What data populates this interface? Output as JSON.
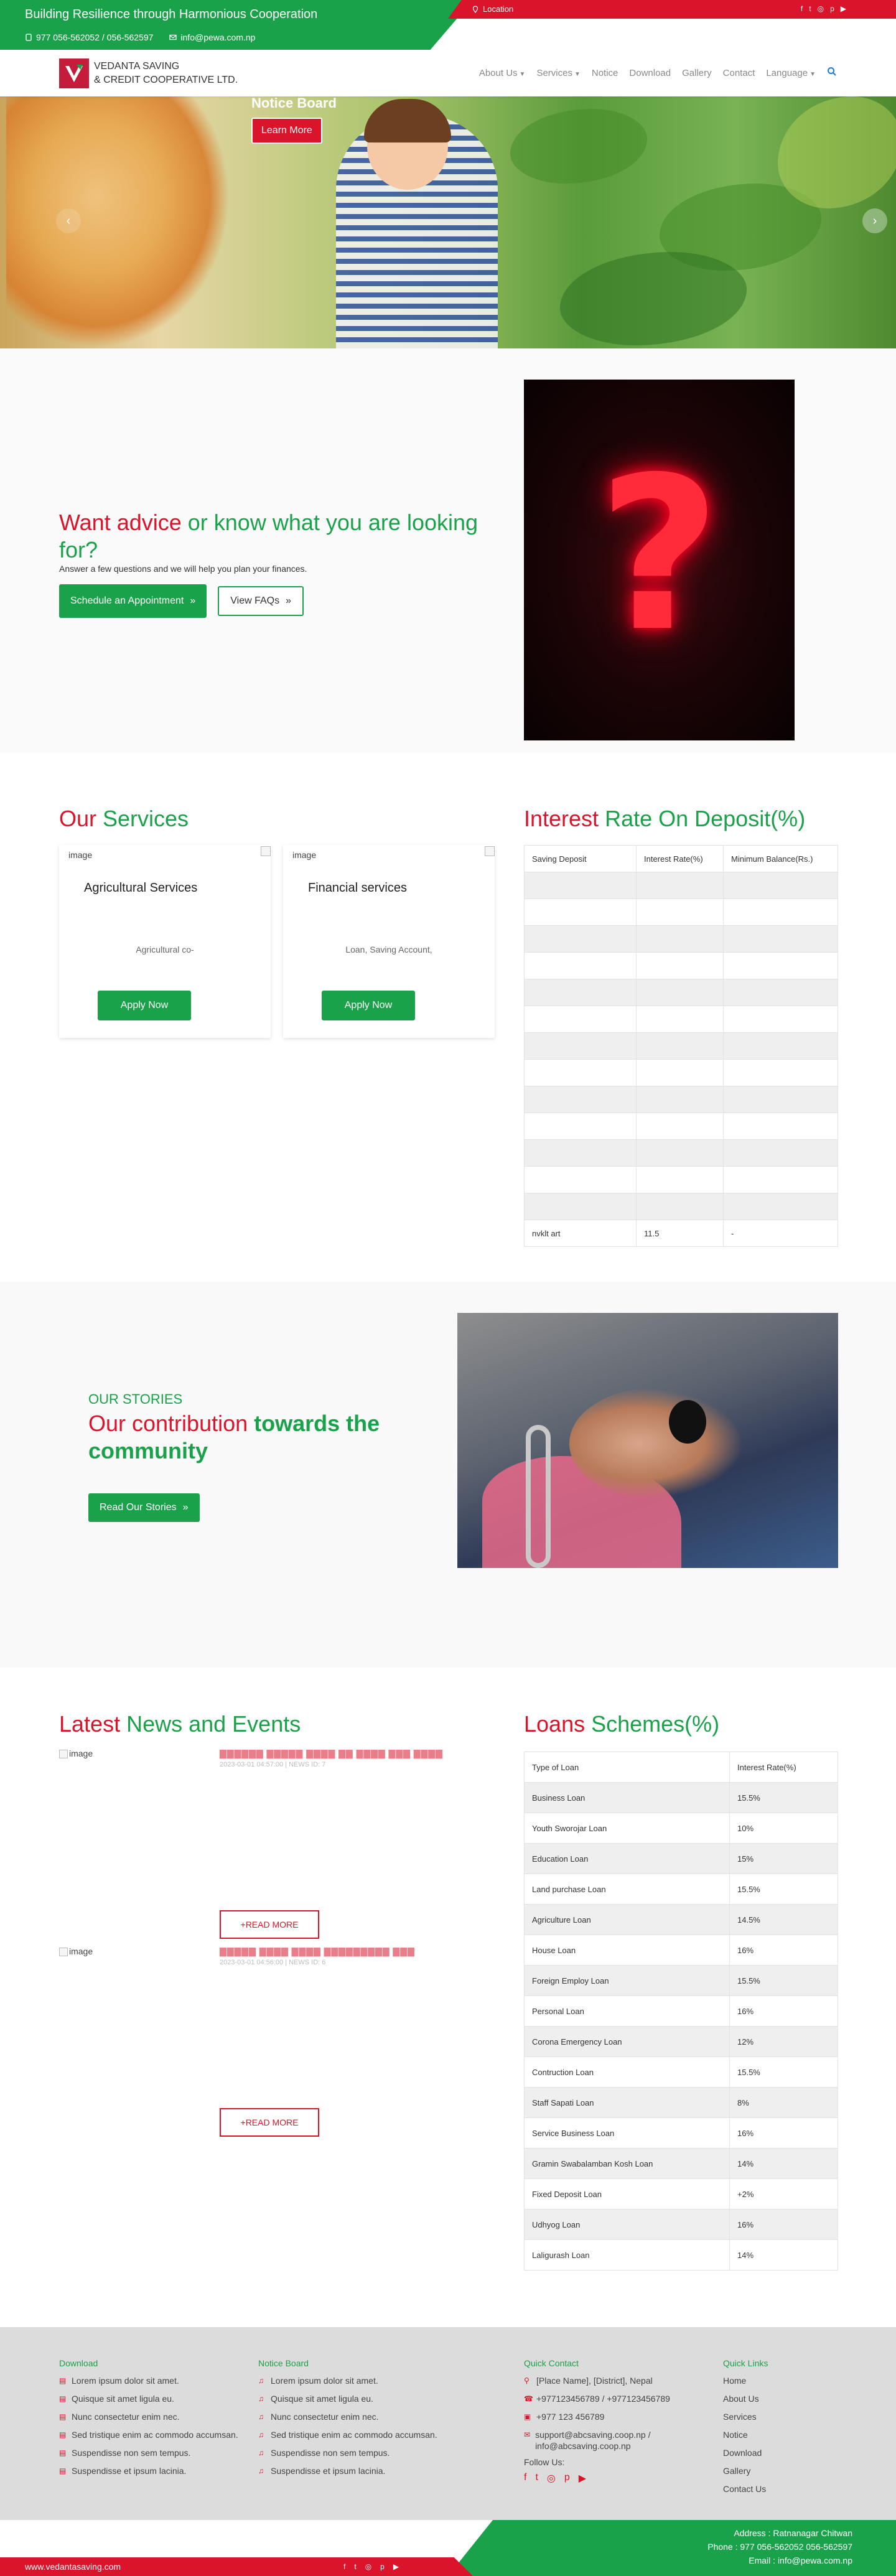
{
  "topbar": {
    "tagline": "Building Resilience through Harmonious Cooperation",
    "phone": "977 056-562052 / 056-562597",
    "email": "info@pewa.com.np",
    "location": "Location",
    "social": [
      "f",
      "t",
      "i",
      "p",
      "y"
    ]
  },
  "navbar": {
    "brand_line1": "VEDANTA SAVING",
    "brand_line2": "& CREDIT COOPERATIVE LTD.",
    "items": [
      "About Us",
      "Services",
      "Notice",
      "Download",
      "Gallery",
      "Contact",
      "Language"
    ]
  },
  "hero": {
    "notice": "Notice Board",
    "button": "Learn More"
  },
  "advice": {
    "title_red": "Want advice",
    "title_green": " or know what you are looking for?",
    "subtitle": "Answer a few questions and we will help you plan your finances.",
    "primary_button": "Schedule an Appointment",
    "secondary_button": "View FAQs"
  },
  "services": {
    "title_red": "Our",
    "title_green": " Services",
    "cards": [
      {
        "img": "image",
        "name": "Agricultural Services",
        "desc": "Agricultural co-",
        "button": "Apply Now"
      },
      {
        "img": "image",
        "name": "Financial services",
        "desc": "Loan, Saving Account,",
        "button": "Apply Now"
      }
    ]
  },
  "interest": {
    "title_red": "Interest",
    "title_green": " Rate On Deposit(%)",
    "headers": [
      "Saving Deposit",
      "Interest Rate(%)",
      "Minimum Balance(Rs.)"
    ],
    "rows": [
      [
        "",
        "",
        ""
      ],
      [
        "",
        "",
        ""
      ],
      [
        "",
        "",
        ""
      ],
      [
        "",
        "",
        ""
      ],
      [
        "",
        "",
        ""
      ],
      [
        "",
        "",
        ""
      ],
      [
        "",
        "",
        ""
      ],
      [
        "",
        "",
        ""
      ],
      [
        "",
        "",
        ""
      ],
      [
        "",
        "",
        ""
      ],
      [
        "",
        "",
        ""
      ],
      [
        "",
        "",
        ""
      ],
      [
        "",
        "",
        ""
      ],
      [
        "nvklt art",
        "11.5",
        "-"
      ]
    ]
  },
  "stories": {
    "label": "OUR STORIES",
    "title_red": "Our contribution",
    "title_green": " towards the community",
    "button": "Read Our Stories"
  },
  "news": {
    "title_red": "Latest",
    "title_green": " News and Events",
    "items": [
      {
        "img": "image",
        "headline": "▇▇▇▇▇▇ ▇▇▇▇▇ ▇▇▇▇ ▇▇ ▇▇▇▇ ▇▇▇ ▇▇▇▇",
        "meta": "2023-03-01 04:57:00 | NEWS ID: 7",
        "button": "+READ MORE"
      },
      {
        "img": "image",
        "headline": "▇▇▇▇▇ ▇▇▇▇ ▇▇▇▇ ▇▇▇▇▇▇▇▇▇ ▇▇▇",
        "meta": "2023-03-01 04:56:00 | NEWS ID: 6",
        "button": "+READ MORE"
      }
    ]
  },
  "loans": {
    "title_red": "Loans",
    "title_green": " Schemes(%)",
    "headers": [
      "Type of Loan",
      "Interest Rate(%)"
    ],
    "rows": [
      [
        "Business Loan",
        "15.5%"
      ],
      [
        "Youth Sworojar Loan",
        "10%"
      ],
      [
        "Education Loan",
        "15%"
      ],
      [
        "Land purchase Loan",
        "15.5%"
      ],
      [
        "Agriculture Loan",
        "14.5%"
      ],
      [
        "House Loan",
        "16%"
      ],
      [
        "Foreign Employ Loan",
        "15.5%"
      ],
      [
        "Personal Loan",
        "16%"
      ],
      [
        "Corona Emergency Loan",
        "12%"
      ],
      [
        "Contruction Loan",
        "15.5%"
      ],
      [
        "Staff Sapati Loan",
        "8%"
      ],
      [
        "Service Business Loan",
        "16%"
      ],
      [
        "Gramin Swabalamban Kosh Loan",
        "14%"
      ],
      [
        "Fixed Deposit Loan",
        "+2%"
      ],
      [
        "Udhyog Loan",
        "16%"
      ],
      [
        "Laligurash Loan",
        "14%"
      ]
    ]
  },
  "footer": {
    "download_title": "Download",
    "download_items": [
      "Lorem ipsum dolor sit amet.",
      "Quisque sit amet ligula eu.",
      "Nunc consectetur enim nec.",
      "Sed tristique enim ac commodo accumsan.",
      "Suspendisse non sem tempus.",
      "Suspendisse et ipsum lacinia."
    ],
    "notice_title": "Notice Board",
    "notice_items": [
      "Lorem ipsum dolor sit amet.",
      "Quisque sit amet ligula eu.",
      "Nunc consectetur enim nec.",
      "Sed tristique enim ac commodo accumsan.",
      "Suspendisse non sem tempus.",
      "Suspendisse et ipsum lacinia."
    ],
    "contact_title": "Quick Contact",
    "contact_address": "[Place Name], [District], Nepal",
    "contact_phone": "+977123456789 / +977123456789",
    "contact_fax": "+977 123 456789",
    "contact_email": "support@abcsaving.coop.np / info@abcsaving.coop.np",
    "follow": "Follow Us:",
    "links_title": "Quick Links",
    "links": [
      "Home",
      "About Us",
      "Services",
      "Notice",
      "Download",
      "Gallery",
      "Contact Us"
    ]
  },
  "bottombar": {
    "site": "www.vedantasaving.com",
    "address": "Address : Ratnanagar Chitwan",
    "phone": "Phone : 977 056-562052 056-562597",
    "email": "Email : info@pewa.com.np"
  },
  "colors": {
    "red": "#d9142b",
    "green": "#1aa24a"
  }
}
